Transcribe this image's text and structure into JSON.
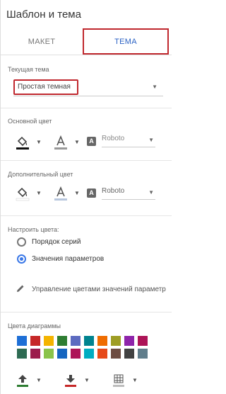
{
  "header": {
    "title": "Шаблон и тема"
  },
  "tabs": [
    {
      "label": "МАКЕТ"
    },
    {
      "label": "ТЕМА"
    }
  ],
  "current_theme": {
    "label": "Текущая тема",
    "value": "Простая темная"
  },
  "primary": {
    "label": "Основной цвет",
    "font": "Roboto"
  },
  "secondary": {
    "label": "Дополнительный цвет",
    "font": "Roboto"
  },
  "configure": {
    "label": "Настроить цвета:",
    "options": [
      {
        "label": "Порядок серий"
      },
      {
        "label": "Значения параметров"
      }
    ],
    "manage_label": "Управление цветами значений параметр"
  },
  "chart_colors": {
    "label": "Цвета диаграммы",
    "row1": [
      "#1e6fd6",
      "#c62828",
      "#f4b400",
      "#2e7d32",
      "#5c6bc0",
      "#00838f",
      "#ef6c00",
      "#9e9d24",
      "#8e24aa",
      "#ad1457"
    ],
    "row2": [
      "#2e6b53",
      "#9c1c4c",
      "#8bc34a",
      "#1565c0",
      "#ad1457",
      "#00acc1",
      "#e64a19",
      "#6d4c41",
      "#424242",
      "#607d8b"
    ]
  },
  "bottom_toolbar": {
    "fill_up_color": "#2e7d32",
    "fill_down_color": "#c62828"
  }
}
